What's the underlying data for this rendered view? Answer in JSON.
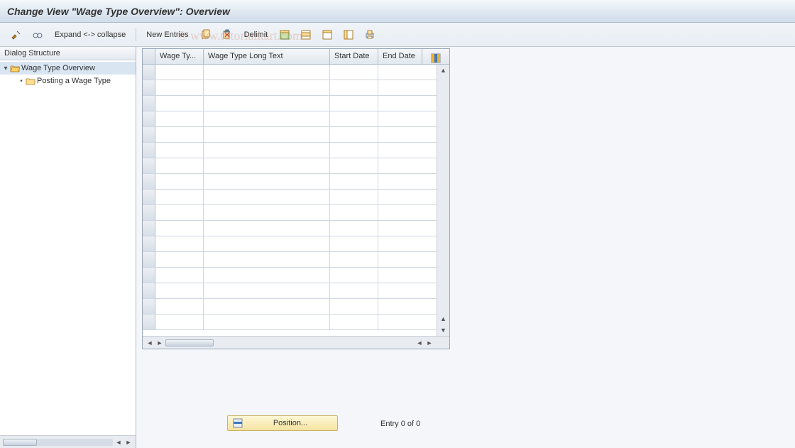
{
  "title": "Change View \"Wage Type Overview\": Overview",
  "toolbar": {
    "expand_collapse": "Expand <-> collapse",
    "new_entries": "New Entries",
    "delimit": "Delimit"
  },
  "dialog_structure": {
    "header": "Dialog Structure",
    "items": [
      {
        "label": "Wage Type Overview",
        "selected": true,
        "open": true
      },
      {
        "label": "Posting a Wage Type",
        "selected": false,
        "open": false
      }
    ]
  },
  "table": {
    "columns": [
      "Wage Ty...",
      "Wage Type Long Text",
      "Start Date",
      "End Date"
    ],
    "rows": 17
  },
  "footer": {
    "position_label": "Position...",
    "entry_status": "Entry 0 of 0"
  },
  "watermark": "© www.tutorialkart.com"
}
